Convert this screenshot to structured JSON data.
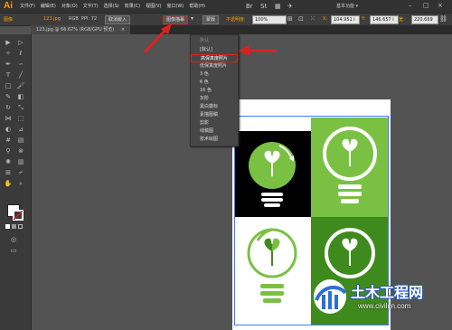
{
  "menubar": {
    "logo": "Ai",
    "menus": [
      "文件(F)",
      "编辑(E)",
      "对象(O)",
      "文字(T)",
      "选择(S)",
      "效果(C)",
      "视图(V)",
      "窗口(W)",
      "帮助(H)"
    ],
    "workspace": "基本功能 ▾",
    "window_controls": [
      "–",
      "□",
      "×"
    ]
  },
  "control_bar": {
    "image_label": "图像",
    "file_name": "123.jpg",
    "color_mode": "RGB",
    "ppi": "PPI: 72",
    "cancel_embed": "取消嵌入",
    "image_trace": "图像描摹",
    "trace_menu_arrow": "▾",
    "mask": "蒙版",
    "opacity_label": "不透明度:",
    "opacity_value": "100%",
    "x_label": "X:",
    "x_value": "104.951 i",
    "y_label": "Y:",
    "y_value": "146.657 i",
    "w_label": "宽:",
    "w_value": "220.669"
  },
  "document_tab": {
    "title": "123.jpg @ 66.67% (RGB/GPU 预览)",
    "close": "×"
  },
  "trace_dropdown": {
    "header": "默认",
    "items": [
      "[默认]",
      "高保真度照片",
      "低保真度照片",
      "3 色",
      "6 色",
      "16 色",
      "灰阶",
      "黑白徽标",
      "素描图稿",
      "剪影",
      "线稿图",
      "技术绘图"
    ],
    "selected_index": 1
  },
  "toolbox": {
    "tools": [
      "selection-tool",
      "direct-selection-tool",
      "magic-wand-tool",
      "lasso-tool",
      "pen-tool",
      "curvature-tool",
      "type-tool",
      "line-tool",
      "rectangle-tool",
      "paintbrush-tool",
      "pencil-tool",
      "eraser-tool",
      "rotate-tool",
      "scale-tool",
      "width-tool",
      "free-transform-tool",
      "shape-builder-tool",
      "perspective-tool",
      "mesh-tool",
      "gradient-tool",
      "eyedropper-tool",
      "blend-tool",
      "symbol-sprayer-tool",
      "column-graph-tool",
      "artboard-tool",
      "slice-tool",
      "hand-tool",
      "zoom-tool"
    ]
  },
  "colors": {
    "green": "#7ac143",
    "dark_green": "#3f8a1c",
    "accent_red": "#e02020",
    "ai_orange": "#ff9a00"
  },
  "watermark": {
    "name": "土木工程网",
    "url": "www.civilcn.com"
  }
}
